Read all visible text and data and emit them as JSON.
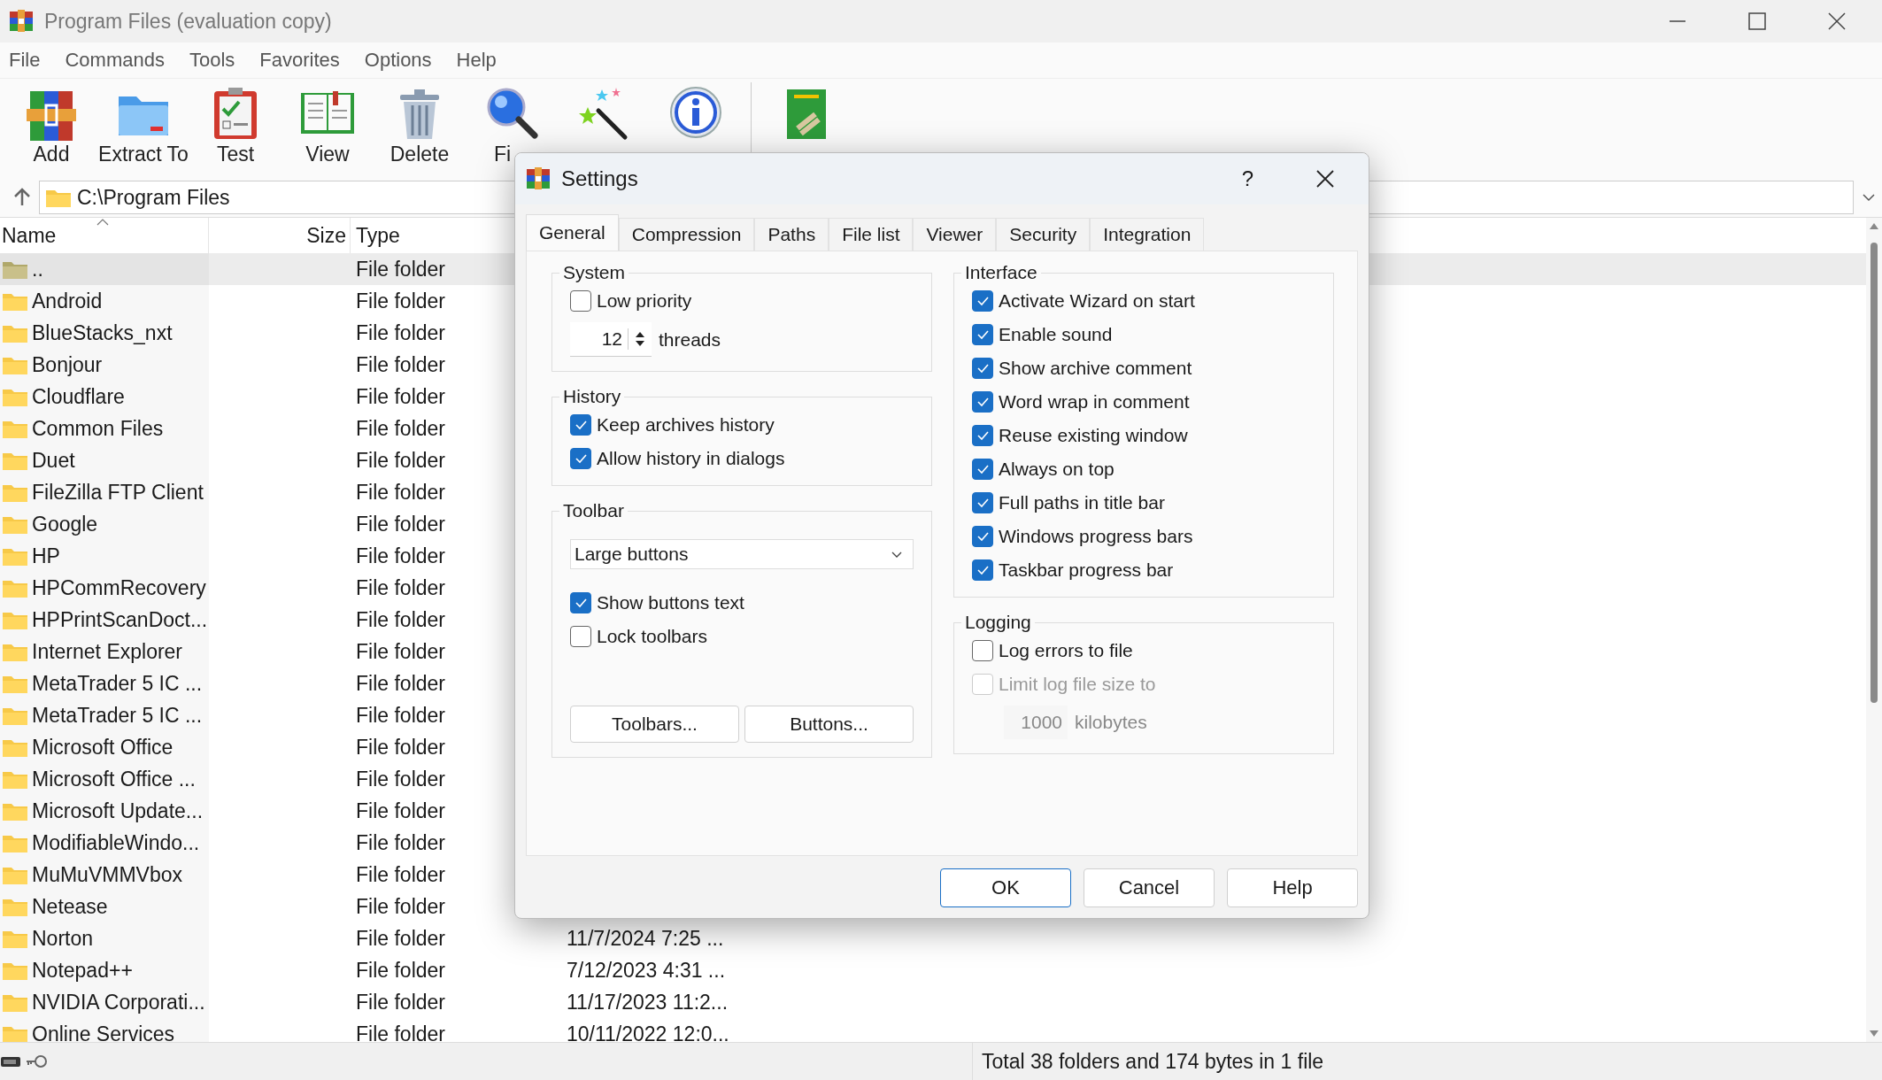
{
  "window": {
    "title": "Program Files (evaluation copy)"
  },
  "menu": [
    "File",
    "Commands",
    "Tools",
    "Favorites",
    "Options",
    "Help"
  ],
  "toolbar": [
    {
      "kind": "add",
      "label": "Add"
    },
    {
      "kind": "extract",
      "label": "Extract To"
    },
    {
      "kind": "test",
      "label": "Test"
    },
    {
      "kind": "view",
      "label": "View"
    },
    {
      "kind": "delete",
      "label": "Delete"
    },
    {
      "kind": "find",
      "label": "Fi"
    },
    {
      "kind": "wizard"
    },
    {
      "kind": "info"
    },
    {
      "kind": "separator"
    },
    {
      "kind": "sfx"
    }
  ],
  "address": {
    "path": "C:\\Program Files"
  },
  "table": {
    "columns": [
      {
        "label": "Name",
        "sorted": true
      },
      {
        "label": "Size",
        "sorted": false
      },
      {
        "label": "Type",
        "sorted": false
      }
    ],
    "rows": [
      {
        "kind": "parent",
        "name": "..",
        "type": "File folder",
        "selected": true
      },
      {
        "kind": "folder",
        "name": "Android",
        "type": "File folder",
        "selected": false
      },
      {
        "kind": "folder",
        "name": "BlueStacks_nxt",
        "type": "File folder",
        "selected": false
      },
      {
        "kind": "folder",
        "name": "Bonjour",
        "type": "File folder",
        "selected": false
      },
      {
        "kind": "folder",
        "name": "Cloudflare",
        "type": "File folder",
        "selected": false
      },
      {
        "kind": "folder",
        "name": "Common Files",
        "type": "File folder",
        "selected": false
      },
      {
        "kind": "folder",
        "name": "Duet",
        "type": "File folder",
        "selected": false
      },
      {
        "kind": "folder",
        "name": "FileZilla FTP Client",
        "type": "File folder",
        "selected": false
      },
      {
        "kind": "folder",
        "name": "Google",
        "type": "File folder",
        "selected": false
      },
      {
        "kind": "folder",
        "name": "HP",
        "type": "File folder",
        "selected": false
      },
      {
        "kind": "folder",
        "name": "HPCommRecovery",
        "type": "File folder",
        "selected": false
      },
      {
        "kind": "folder",
        "name": "HPPrintScanDoct...",
        "type": "File folder",
        "selected": false
      },
      {
        "kind": "folder",
        "name": "Internet Explorer",
        "type": "File folder",
        "selected": false
      },
      {
        "kind": "folder",
        "name": "MetaTrader 5 IC ...",
        "type": "File folder",
        "selected": false
      },
      {
        "kind": "folder",
        "name": "MetaTrader 5 IC ...",
        "type": "File folder",
        "selected": false
      },
      {
        "kind": "folder",
        "name": "Microsoft Office",
        "type": "File folder",
        "selected": false
      },
      {
        "kind": "folder",
        "name": "Microsoft Office ...",
        "type": "File folder",
        "selected": false
      },
      {
        "kind": "folder",
        "name": "Microsoft Update...",
        "type": "File folder",
        "selected": false
      },
      {
        "kind": "folder",
        "name": "ModifiableWindo...",
        "type": "File folder",
        "selected": false
      },
      {
        "kind": "folder",
        "name": "MuMuVMMVbox",
        "type": "File folder",
        "selected": false
      },
      {
        "kind": "folder",
        "name": "Netease",
        "type": "File folder",
        "selected": false
      },
      {
        "kind": "folder",
        "name": "Norton",
        "type": "File folder",
        "modified": "11/7/2024 7:25 ...",
        "selected": false
      },
      {
        "kind": "folder",
        "name": "Notepad++",
        "type": "File folder",
        "modified": "7/12/2023 4:31 ...",
        "selected": false
      },
      {
        "kind": "folder",
        "name": "NVIDIA Corporati...",
        "type": "File folder",
        "modified": "11/17/2023 11:2...",
        "selected": false
      },
      {
        "kind": "folder",
        "name": "Online Services",
        "type": "File folder",
        "modified": "10/11/2022 12:0...",
        "selected": false
      }
    ]
  },
  "status_bar": {
    "text": "Total 38 folders and 174 bytes in 1 file"
  },
  "dialog": {
    "title": "Settings",
    "help": "?",
    "tabs": [
      {
        "label": "General",
        "selected": true
      },
      {
        "label": "Compression",
        "selected": false
      },
      {
        "label": "Paths",
        "selected": false
      },
      {
        "label": "File list",
        "selected": false
      },
      {
        "label": "Viewer",
        "selected": false
      },
      {
        "label": "Security",
        "selected": false
      },
      {
        "label": "Integration",
        "selected": false
      }
    ],
    "columns": [
      {
        "groups": [
          {
            "title": "System",
            "items": [
              {
                "kind": "checkbox",
                "label": "Low priority",
                "checked": false,
                "disabled": false
              },
              {
                "kind": "spinner",
                "value": "12",
                "unit": "threads"
              }
            ]
          },
          {
            "title": "History",
            "items": [
              {
                "kind": "checkbox",
                "label": "Keep archives history",
                "checked": true,
                "disabled": false
              },
              {
                "kind": "checkbox",
                "label": "Allow history in dialogs",
                "checked": true,
                "disabled": false
              }
            ]
          },
          {
            "title": "Toolbar",
            "items": [
              {
                "kind": "dropdown",
                "value": "Large buttons"
              },
              {
                "kind": "checkbox",
                "label": "Show buttons text",
                "checked": true,
                "disabled": false
              },
              {
                "kind": "checkbox",
                "label": "Lock toolbars",
                "checked": false,
                "disabled": false
              },
              {
                "kind": "buttons",
                "labels": [
                  "Toolbars...",
                  "Buttons..."
                ]
              }
            ]
          }
        ]
      },
      {
        "groups": [
          {
            "title": "Interface",
            "items": [
              {
                "kind": "checkbox",
                "label": "Activate Wizard on start",
                "checked": true,
                "disabled": false
              },
              {
                "kind": "checkbox",
                "label": "Enable sound",
                "checked": true,
                "disabled": false
              },
              {
                "kind": "checkbox",
                "label": "Show archive comment",
                "checked": true,
                "disabled": false
              },
              {
                "kind": "checkbox",
                "label": "Word wrap in comment",
                "checked": true,
                "disabled": false
              },
              {
                "kind": "checkbox",
                "label": "Reuse existing window",
                "checked": true,
                "disabled": false
              },
              {
                "kind": "checkbox",
                "label": "Always on top",
                "checked": true,
                "disabled": false
              },
              {
                "kind": "checkbox",
                "label": "Full paths in title bar",
                "checked": true,
                "disabled": false
              },
              {
                "kind": "checkbox",
                "label": "Windows progress bars",
                "checked": true,
                "disabled": false
              },
              {
                "kind": "checkbox",
                "label": "Taskbar progress bar",
                "checked": true,
                "disabled": false
              }
            ]
          },
          {
            "title": "Logging",
            "items": [
              {
                "kind": "checkbox",
                "label": "Log errors to file",
                "checked": false,
                "disabled": false
              },
              {
                "kind": "checkbox",
                "label": "Limit log file size to",
                "checked": false,
                "disabled": true
              },
              {
                "kind": "number",
                "value": "1000",
                "unit": "kilobytes",
                "disabled": true
              }
            ]
          }
        ]
      }
    ],
    "buttons": [
      {
        "label": "OK",
        "default": true
      },
      {
        "label": "Cancel",
        "default": false
      },
      {
        "label": "Help",
        "default": false
      }
    ]
  }
}
